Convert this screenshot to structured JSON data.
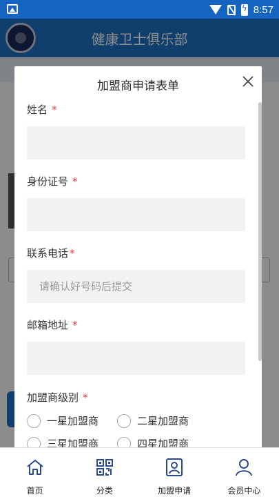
{
  "status_bar": {
    "time": "8:57"
  },
  "app": {
    "title": "健康卫士俱乐部"
  },
  "modal": {
    "title": "加盟商申请表单",
    "required_mark": "*",
    "fields": [
      {
        "label": "姓名",
        "value": "",
        "placeholder": ""
      },
      {
        "label": "身份证号",
        "value": "",
        "placeholder": ""
      },
      {
        "label": "联系电话",
        "value": "",
        "placeholder": "请确认好号码后提交"
      },
      {
        "label": "邮箱地址",
        "value": "",
        "placeholder": ""
      }
    ],
    "level": {
      "label": "加盟商级别",
      "options": [
        "一星加盟商",
        "二星加盟商",
        "三星加盟商",
        "四星加盟商"
      ]
    }
  },
  "bottom_nav": {
    "items": [
      {
        "label": "首页",
        "icon": "home-icon"
      },
      {
        "label": "分类",
        "icon": "qr-grid-icon"
      },
      {
        "label": "加盟申请",
        "icon": "id-card-icon"
      },
      {
        "label": "会员中心",
        "icon": "person-icon"
      }
    ]
  }
}
